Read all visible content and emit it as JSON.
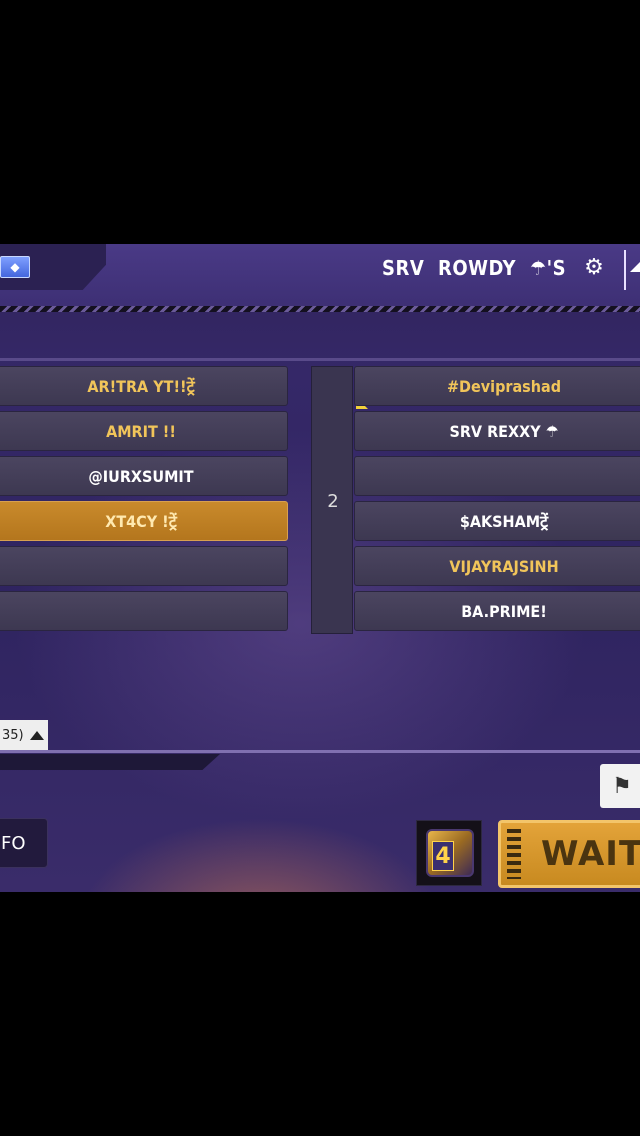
{
  "topbar": {
    "team_words": [
      "SRV",
      "ROWDY",
      "☂'S"
    ],
    "gem_icon": "diamond-icon",
    "settings_icon": "gear-icon",
    "home_icon": "home-icon"
  },
  "left_team": {
    "slots": [
      "AR!TRA  YT!!ट्रें",
      "AMRIT !!",
      "@IURXSUMIT",
      "XT4CY  !ट्रें",
      "",
      ""
    ],
    "active_index": 3
  },
  "middle": {
    "number": "2"
  },
  "right_team": {
    "slots": [
      "#Deviprashad",
      "SRV  REXXY  ☂",
      "",
      "$AKSHAMट्रें",
      "VIJAYRAJSINH",
      "BA.PRIME!"
    ]
  },
  "bottom": {
    "count_text": "35)",
    "info_label": "FO",
    "dice_number": "4",
    "wait_label": "WAIT",
    "flag_icon": "flag-add-icon"
  },
  "colors": {
    "accent_gold": "#f1c55a",
    "active_slot": "#c98a2c",
    "background": "#30245a"
  }
}
